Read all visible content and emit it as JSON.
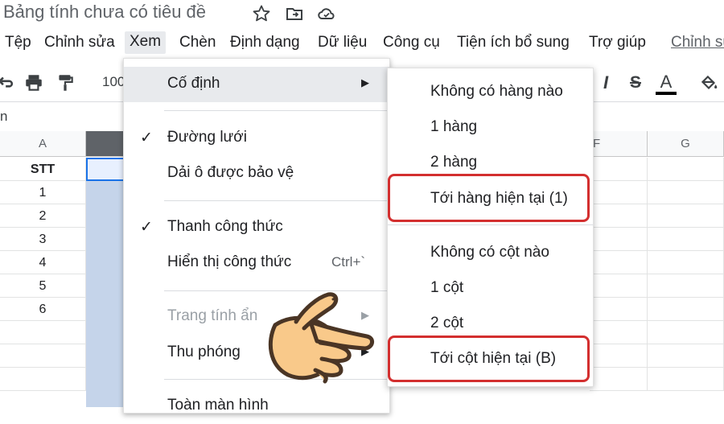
{
  "title_bar": {
    "doc_title": "Bảng tính chưa có tiêu đề",
    "icons": [
      "star-icon",
      "move-to-folder-icon",
      "cloud-status-icon"
    ]
  },
  "menu_bar": {
    "items": [
      "Tệp",
      "Chỉnh sửa",
      "Xem",
      "Chèn",
      "Định dạng",
      "Dữ liệu",
      "Công cụ",
      "Tiện ích bổ sung",
      "Trợ giúp"
    ],
    "active": "Xem",
    "last_edit_link": "Chỉnh sửa"
  },
  "toolbar": {
    "zoom": "100",
    "icons": [
      "undo-icon",
      "print-icon",
      "paint-format-icon",
      "italic-icon",
      "strikethrough-icon",
      "text-color-icon",
      "fill-color-icon"
    ],
    "italic": "I",
    "strike": "S",
    "text_color": "A"
  },
  "formula_bar": {
    "name_box": "n"
  },
  "grid": {
    "columns": [
      "A",
      "F",
      "G"
    ],
    "header_cell": "STT",
    "rows": [
      "1",
      "2",
      "3",
      "4",
      "5",
      "6"
    ]
  },
  "view_menu": {
    "freeze": "Cố định",
    "gridlines": "Đường lưới",
    "protected_ranges": "Dải ô được bảo vệ",
    "formula_bar": "Thanh công thức",
    "show_formulas": "Hiển thị công thức",
    "show_formulas_shortcut": "Ctrl+`",
    "hidden_sheets": "Trang tính ẩn",
    "zoom": "Thu phóng",
    "full_screen": "Toàn màn hình",
    "check": "✓",
    "arrow": "▶"
  },
  "freeze_submenu": {
    "no_rows": "Không có hàng nào",
    "one_row": "1 hàng",
    "two_rows": "2 hàng",
    "up_to_row": "Tới hàng hiện tại (1)",
    "no_columns": "Không có cột nào",
    "one_col": "1 cột",
    "two_cols": "2 cột",
    "up_to_col": "Tới cột hiện tại (B)"
  },
  "colors": {
    "accent": "#1a73e8",
    "callout": "#d32f2f",
    "menu_highlight": "#e8eaed",
    "selected_column": "#c5d4ea",
    "hand_fill": "#f9c98a",
    "hand_outline": "#4a3525"
  }
}
